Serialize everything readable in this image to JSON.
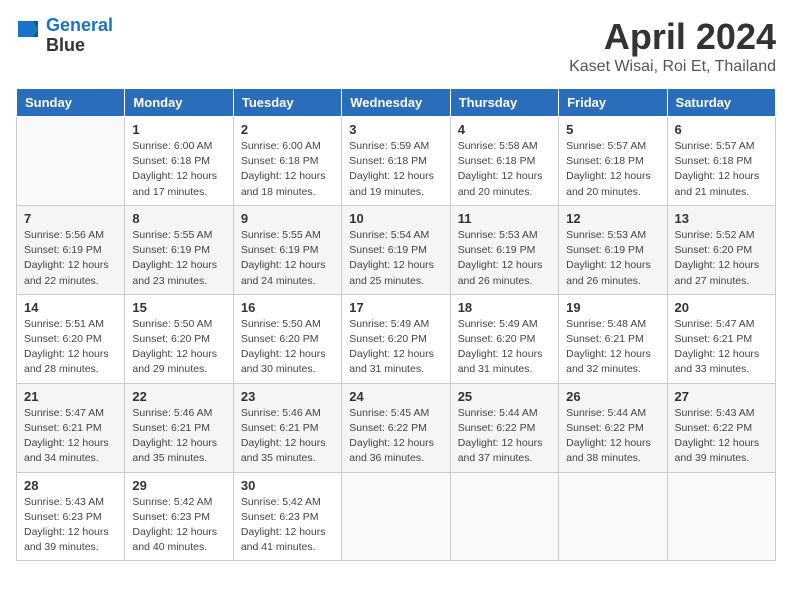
{
  "header": {
    "logo_line1": "General",
    "logo_line2": "Blue",
    "title": "April 2024",
    "subtitle": "Kaset Wisai, Roi Et, Thailand"
  },
  "days_of_week": [
    "Sunday",
    "Monday",
    "Tuesday",
    "Wednesday",
    "Thursday",
    "Friday",
    "Saturday"
  ],
  "weeks": [
    [
      {
        "day": "",
        "info": ""
      },
      {
        "day": "1",
        "info": "Sunrise: 6:00 AM\nSunset: 6:18 PM\nDaylight: 12 hours\nand 17 minutes."
      },
      {
        "day": "2",
        "info": "Sunrise: 6:00 AM\nSunset: 6:18 PM\nDaylight: 12 hours\nand 18 minutes."
      },
      {
        "day": "3",
        "info": "Sunrise: 5:59 AM\nSunset: 6:18 PM\nDaylight: 12 hours\nand 19 minutes."
      },
      {
        "day": "4",
        "info": "Sunrise: 5:58 AM\nSunset: 6:18 PM\nDaylight: 12 hours\nand 20 minutes."
      },
      {
        "day": "5",
        "info": "Sunrise: 5:57 AM\nSunset: 6:18 PM\nDaylight: 12 hours\nand 20 minutes."
      },
      {
        "day": "6",
        "info": "Sunrise: 5:57 AM\nSunset: 6:18 PM\nDaylight: 12 hours\nand 21 minutes."
      }
    ],
    [
      {
        "day": "7",
        "info": "Sunrise: 5:56 AM\nSunset: 6:19 PM\nDaylight: 12 hours\nand 22 minutes."
      },
      {
        "day": "8",
        "info": "Sunrise: 5:55 AM\nSunset: 6:19 PM\nDaylight: 12 hours\nand 23 minutes."
      },
      {
        "day": "9",
        "info": "Sunrise: 5:55 AM\nSunset: 6:19 PM\nDaylight: 12 hours\nand 24 minutes."
      },
      {
        "day": "10",
        "info": "Sunrise: 5:54 AM\nSunset: 6:19 PM\nDaylight: 12 hours\nand 25 minutes."
      },
      {
        "day": "11",
        "info": "Sunrise: 5:53 AM\nSunset: 6:19 PM\nDaylight: 12 hours\nand 26 minutes."
      },
      {
        "day": "12",
        "info": "Sunrise: 5:53 AM\nSunset: 6:19 PM\nDaylight: 12 hours\nand 26 minutes."
      },
      {
        "day": "13",
        "info": "Sunrise: 5:52 AM\nSunset: 6:20 PM\nDaylight: 12 hours\nand 27 minutes."
      }
    ],
    [
      {
        "day": "14",
        "info": "Sunrise: 5:51 AM\nSunset: 6:20 PM\nDaylight: 12 hours\nand 28 minutes."
      },
      {
        "day": "15",
        "info": "Sunrise: 5:50 AM\nSunset: 6:20 PM\nDaylight: 12 hours\nand 29 minutes."
      },
      {
        "day": "16",
        "info": "Sunrise: 5:50 AM\nSunset: 6:20 PM\nDaylight: 12 hours\nand 30 minutes."
      },
      {
        "day": "17",
        "info": "Sunrise: 5:49 AM\nSunset: 6:20 PM\nDaylight: 12 hours\nand 31 minutes."
      },
      {
        "day": "18",
        "info": "Sunrise: 5:49 AM\nSunset: 6:20 PM\nDaylight: 12 hours\nand 31 minutes."
      },
      {
        "day": "19",
        "info": "Sunrise: 5:48 AM\nSunset: 6:21 PM\nDaylight: 12 hours\nand 32 minutes."
      },
      {
        "day": "20",
        "info": "Sunrise: 5:47 AM\nSunset: 6:21 PM\nDaylight: 12 hours\nand 33 minutes."
      }
    ],
    [
      {
        "day": "21",
        "info": "Sunrise: 5:47 AM\nSunset: 6:21 PM\nDaylight: 12 hours\nand 34 minutes."
      },
      {
        "day": "22",
        "info": "Sunrise: 5:46 AM\nSunset: 6:21 PM\nDaylight: 12 hours\nand 35 minutes."
      },
      {
        "day": "23",
        "info": "Sunrise: 5:46 AM\nSunset: 6:21 PM\nDaylight: 12 hours\nand 35 minutes."
      },
      {
        "day": "24",
        "info": "Sunrise: 5:45 AM\nSunset: 6:22 PM\nDaylight: 12 hours\nand 36 minutes."
      },
      {
        "day": "25",
        "info": "Sunrise: 5:44 AM\nSunset: 6:22 PM\nDaylight: 12 hours\nand 37 minutes."
      },
      {
        "day": "26",
        "info": "Sunrise: 5:44 AM\nSunset: 6:22 PM\nDaylight: 12 hours\nand 38 minutes."
      },
      {
        "day": "27",
        "info": "Sunrise: 5:43 AM\nSunset: 6:22 PM\nDaylight: 12 hours\nand 39 minutes."
      }
    ],
    [
      {
        "day": "28",
        "info": "Sunrise: 5:43 AM\nSunset: 6:23 PM\nDaylight: 12 hours\nand 39 minutes."
      },
      {
        "day": "29",
        "info": "Sunrise: 5:42 AM\nSunset: 6:23 PM\nDaylight: 12 hours\nand 40 minutes."
      },
      {
        "day": "30",
        "info": "Sunrise: 5:42 AM\nSunset: 6:23 PM\nDaylight: 12 hours\nand 41 minutes."
      },
      {
        "day": "",
        "info": ""
      },
      {
        "day": "",
        "info": ""
      },
      {
        "day": "",
        "info": ""
      },
      {
        "day": "",
        "info": ""
      }
    ]
  ]
}
